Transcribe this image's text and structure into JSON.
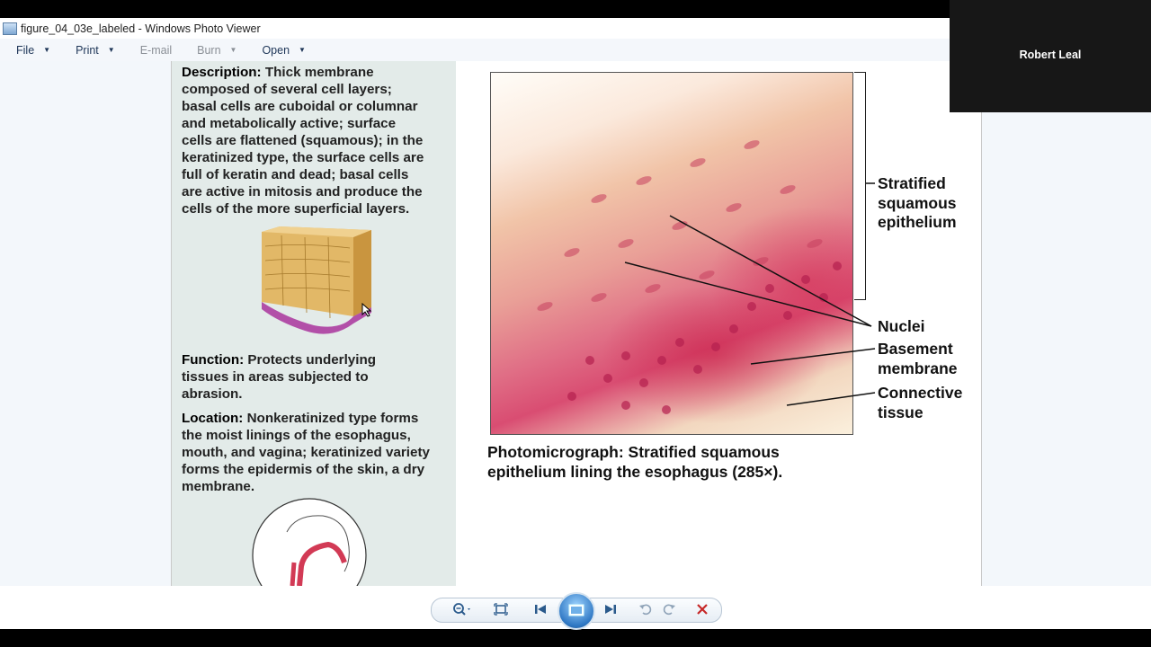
{
  "window": {
    "title": "figure_04_03e_labeled - Windows Photo Viewer"
  },
  "menu": [
    {
      "label": "File",
      "enabled": true
    },
    {
      "label": "Print",
      "enabled": true
    },
    {
      "label": "E-mail",
      "enabled": false
    },
    {
      "label": "Burn",
      "enabled": false
    },
    {
      "label": "Open",
      "enabled": true
    }
  ],
  "figure": {
    "description_head": "Description:",
    "description_lines": [
      "Thick membrane",
      "composed of several cell layers;",
      "basal cells are cuboidal or columnar",
      "and metabolically active; surface",
      "cells are flattened (squamous); in the",
      "keratinized type, the surface cells are",
      "full of keratin and dead; basal cells",
      "are active in mitosis and produce the",
      "cells of the more superficial layers."
    ],
    "function_head": "Function:",
    "function_lines": [
      "Protects underlying",
      "tissues in areas subjected to",
      "abrasion."
    ],
    "location_head": "Location:",
    "location_lines": [
      "Nonkeratinized type forms",
      "the moist linings of the esophagus,",
      "mouth, and vagina; keratinized variety",
      "forms the epidermis of the skin, a dry",
      "membrane."
    ],
    "labels": {
      "stratified": [
        "Stratified",
        "squamous",
        "epithelium"
      ],
      "nuclei": "Nuclei",
      "basement": [
        "Basement",
        "membrane"
      ],
      "connective": [
        "Connective",
        "tissue"
      ]
    },
    "caption_head": "Photomicrograph:",
    "caption_line1": "Stratified squamous",
    "caption_line2": "epithelium lining the esophagus (285×)."
  },
  "webcam": {
    "name": "Robert Leal"
  },
  "toolbar": {
    "buttons": [
      "zoom-icon",
      "actual-size-icon",
      "previous-icon",
      "slideshow-icon",
      "next-icon",
      "rotate-left-icon",
      "rotate-right-icon",
      "delete-icon"
    ],
    "accent": "#2f78c4",
    "delete_color": "#c62828"
  }
}
